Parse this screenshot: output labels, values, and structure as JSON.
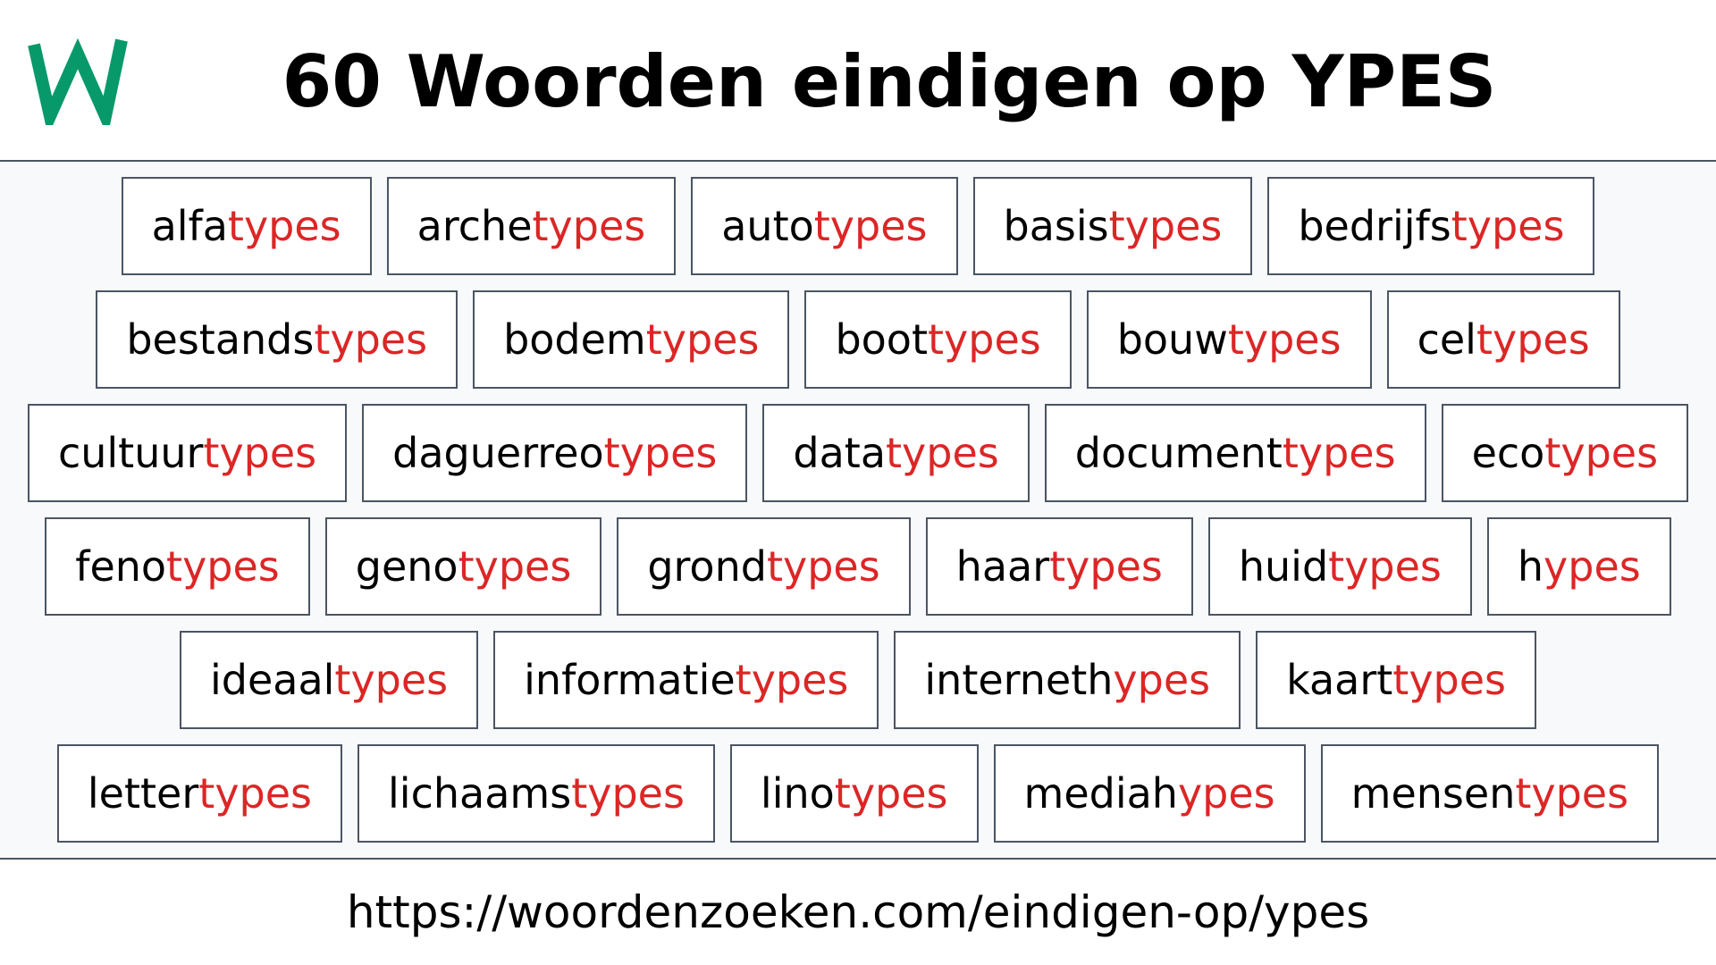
{
  "header": {
    "logo_letter": "W",
    "logo_color": "#07996a",
    "title": "60 Woorden eindigen op YPES"
  },
  "colors": {
    "suffix": "#dc2626",
    "border": "#4b5563",
    "background": "#f8f9fb"
  },
  "suffix": "types",
  "rows": [
    [
      {
        "stem": "alfa",
        "suffix": "types"
      },
      {
        "stem": "arche",
        "suffix": "types"
      },
      {
        "stem": "auto",
        "suffix": "types"
      },
      {
        "stem": "basis",
        "suffix": "types"
      },
      {
        "stem": "bedrijfs",
        "suffix": "types"
      }
    ],
    [
      {
        "stem": "bestands",
        "suffix": "types"
      },
      {
        "stem": "bodem",
        "suffix": "types"
      },
      {
        "stem": "boot",
        "suffix": "types"
      },
      {
        "stem": "bouw",
        "suffix": "types"
      },
      {
        "stem": "cel",
        "suffix": "types"
      }
    ],
    [
      {
        "stem": "cultuur",
        "suffix": "types"
      },
      {
        "stem": "daguerreo",
        "suffix": "types"
      },
      {
        "stem": "data",
        "suffix": "types"
      },
      {
        "stem": "document",
        "suffix": "types"
      },
      {
        "stem": "eco",
        "suffix": "types"
      }
    ],
    [
      {
        "stem": "feno",
        "suffix": "types"
      },
      {
        "stem": "geno",
        "suffix": "types"
      },
      {
        "stem": "grond",
        "suffix": "types"
      },
      {
        "stem": "haar",
        "suffix": "types"
      },
      {
        "stem": "huid",
        "suffix": "types"
      },
      {
        "stem": "h",
        "suffix": "ypes"
      }
    ],
    [
      {
        "stem": "ideaal",
        "suffix": "types"
      },
      {
        "stem": "informatie",
        "suffix": "types"
      },
      {
        "stem": "interneth",
        "suffix": "ypes"
      },
      {
        "stem": "kaart",
        "suffix": "types"
      }
    ],
    [
      {
        "stem": "letter",
        "suffix": "types"
      },
      {
        "stem": "lichaams",
        "suffix": "types"
      },
      {
        "stem": "lino",
        "suffix": "types"
      },
      {
        "stem": "mediah",
        "suffix": "ypes"
      },
      {
        "stem": "mensen",
        "suffix": "types"
      }
    ]
  ],
  "footer": {
    "url": "https://woordenzoeken.com/eindigen-op/ypes"
  }
}
